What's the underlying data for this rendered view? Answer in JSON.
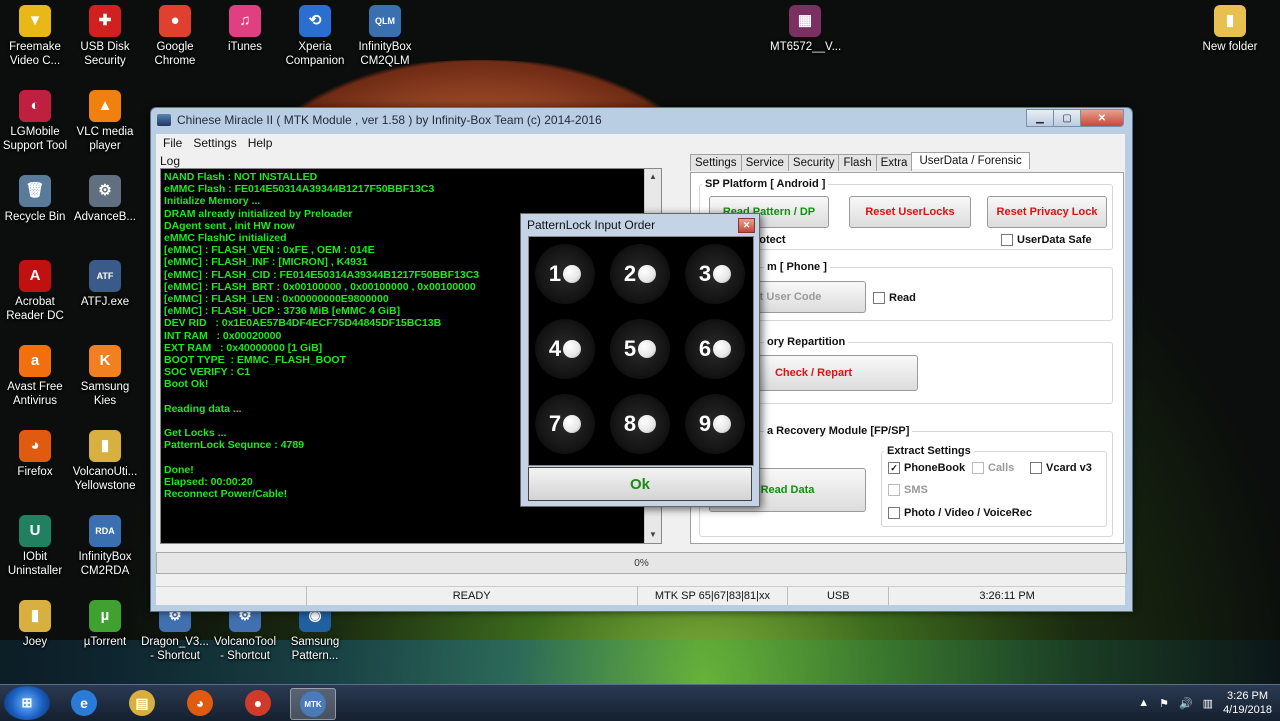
{
  "desktop": {
    "icons": [
      {
        "label": "Freemake\nVideo C...",
        "glyph": "▼",
        "color": "#e8b818"
      },
      {
        "label": "USB Disk\nSecurity",
        "glyph": "✚",
        "color": "#d02020"
      },
      {
        "label": "Google\nChrome",
        "glyph": "●",
        "color": "#e04030"
      },
      {
        "label": "iTunes",
        "glyph": "♫",
        "color": "#e04080"
      },
      {
        "label": "Xperia\nCompanion",
        "glyph": "⟲",
        "color": "#2a6fd0"
      },
      {
        "label": "InfinityBox\nCM2QLM",
        "glyph": "QLM",
        "color": "#3a6fb0"
      },
      {
        "label": "MT6572__V...",
        "glyph": "▦",
        "color": "#7a3060"
      },
      {
        "label": "New folder",
        "glyph": "▮",
        "color": "#e8c050"
      },
      {
        "label": "LGMobile\nSupport Tool",
        "glyph": "◐",
        "color": "#c02040"
      },
      {
        "label": "VLC media\nplayer",
        "glyph": "▲",
        "color": "#f08010"
      },
      {
        "label": "Recycle Bin",
        "glyph": "🗑",
        "color": "#5a7a9a"
      },
      {
        "label": "AdvanceB...",
        "glyph": "⚙",
        "color": "#607080"
      },
      {
        "label": "Acrobat\nReader DC",
        "glyph": "A",
        "color": "#c01010"
      },
      {
        "label": "ATFJ.exe",
        "glyph": "ATF",
        "color": "#3a5a8a"
      },
      {
        "label": "Avast Free\nAntivirus",
        "glyph": "a",
        "color": "#f07010"
      },
      {
        "label": "Samsung\nKies",
        "glyph": "K",
        "color": "#f08020"
      },
      {
        "label": "Firefox",
        "glyph": "◕",
        "color": "#e05a10"
      },
      {
        "label": "VolcanoUti...\nYellowstone",
        "glyph": "▮",
        "color": "#d8b040"
      },
      {
        "label": "IObit\nUninstaller",
        "glyph": "U",
        "color": "#208060"
      },
      {
        "label": "InfinityBox\nCM2RDA",
        "glyph": "RDA",
        "color": "#3a6fb0"
      },
      {
        "label": "Joey",
        "glyph": "▮",
        "color": "#d8b040"
      },
      {
        "label": "µTorrent",
        "glyph": "µ",
        "color": "#40a030"
      },
      {
        "label": "Dragon_V3...\n- Shortcut",
        "glyph": "⚙",
        "color": "#4070b0"
      },
      {
        "label": "VolcanoTool\n- Shortcut",
        "glyph": "⚙",
        "color": "#4070b0"
      },
      {
        "label": "Samsung\nPattern...",
        "glyph": "◉",
        "color": "#2060a0"
      }
    ]
  },
  "window": {
    "title": "Chinese Miracle II ( MTK Module , ver 1.58 ) by Infinity-Box Team (c) 2014-2016",
    "menu": [
      "File",
      "Settings",
      "Help"
    ],
    "log_label": "Log",
    "log_lines": [
      "NAND Flash : NOT INSTALLED",
      "eMMC Flash : FE014E50314A39344B1217F50BBF13C3",
      "Initialize Memory ...",
      "DRAM already initialized by Preloader",
      "DAgent sent , init HW now",
      "eMMC FlashIC initialized",
      "[eMMC] : FLASH_VEN : 0xFE , OEM : 014E",
      "[eMMC] : FLASH_INF : [MICRON] , K4931",
      "[eMMC] : FLASH_CID : FE014E50314A39344B1217F50BBF13C3",
      "[eMMC] : FLASH_BRT : 0x00100000 , 0x00100000 , 0x00100000",
      "[eMMC] : FLASH_LEN : 0x00000000E9800000",
      "[eMMC] : FLASH_UCP : 3736 MiB [eMMC 4 GiB]",
      "DEV RID   : 0x1E0AE57B4DF4ECF75D44845DF15BC13B",
      "INT RAM   : 0x00020000",
      "EXT RAM   : 0x40000000 [1 GiB]",
      "BOOT TYPE  : EMMC_FLASH_BOOT",
      "SOC VERIFY : C1",
      "Boot Ok!",
      "",
      "Reading data ...",
      "",
      "Get Locks ...",
      "PatternLock Sequnce : 4789",
      "",
      "Done!",
      "Elapsed: 00:00:20",
      "Reconnect Power/Cable!"
    ],
    "tabs": [
      "Settings",
      "Service",
      "Security",
      "Flash",
      "Extra",
      "UserData / Forensic"
    ],
    "active_tab": "UserData / Forensic",
    "panel": {
      "sp_platform_title": "SP Platform [ Android ]",
      "btn_pattern": "Read Pattern / DP",
      "btn_reset_userlocks": "Reset UserLocks",
      "btn_reset_privacy": "Reset Privacy Lock",
      "protect_label": "rotect",
      "userdata_safe_label": "UserData Safe",
      "phone_group_title": "m [ Phone ]",
      "btn_reset_usercode": "et User Code",
      "read_label": "Read",
      "repartition_title": "ory Repartition",
      "btn_check_repart": "Check / Repart",
      "recovery_title": "a Recovery Module  [FP/SP]",
      "btn_read_data": "Read Data",
      "extract_title": "Extract Settings",
      "chk_phonebook": "PhoneBook",
      "chk_calls": "Calls",
      "chk_vcard": "Vcard v3",
      "chk_sms": "SMS",
      "chk_photo": "Photo / Video / VoiceRec"
    },
    "progress": "0%",
    "status": {
      "state": "READY",
      "chip": "MTK SP 65|67|83|81|xx",
      "port": "USB",
      "time": "3:26:11 PM"
    }
  },
  "dialog": {
    "title": "PatternLock Input Order",
    "dots": [
      "1",
      "2",
      "3",
      "4",
      "5",
      "6",
      "7",
      "8",
      "9"
    ],
    "ok": "Ok"
  },
  "taskbar": {
    "start": "⊞",
    "apps": [
      {
        "name": "internet-explorer-icon",
        "glyph": "e",
        "color": "#2a7ad8"
      },
      {
        "name": "file-explorer-icon",
        "glyph": "▤",
        "color": "#d8b040"
      },
      {
        "name": "firefox-icon",
        "glyph": "◕",
        "color": "#e05a10"
      },
      {
        "name": "chrome-icon",
        "glyph": "●",
        "color": "#d03a2a"
      },
      {
        "name": "mtk-cm2-icon",
        "glyph": "MTK",
        "color": "#4a7ab8"
      }
    ],
    "clock_time": "3:26 PM",
    "clock_date": "4/19/2018"
  }
}
